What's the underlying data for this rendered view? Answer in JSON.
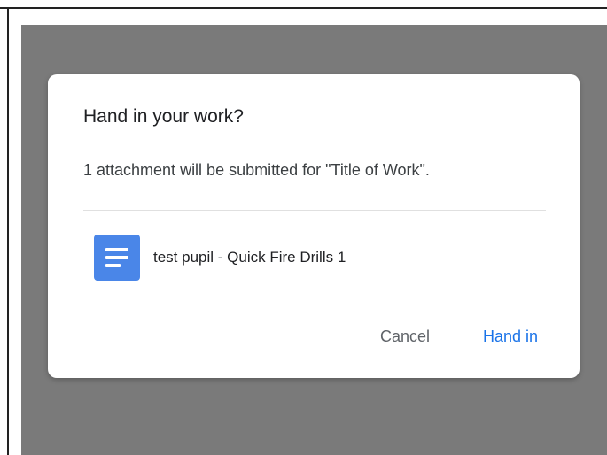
{
  "dialog": {
    "title": "Hand in your work?",
    "message": "1 attachment will be submitted for \"Title of Work\".",
    "attachment": {
      "icon": "google-docs-icon",
      "name": "test pupil - Quick Fire Drills 1"
    },
    "cancel_label": "Cancel",
    "submit_label": "Hand in"
  },
  "colors": {
    "backdrop": "#7a7a7a",
    "accent": "#1a73e8",
    "doc_icon": "#4a86e8"
  }
}
